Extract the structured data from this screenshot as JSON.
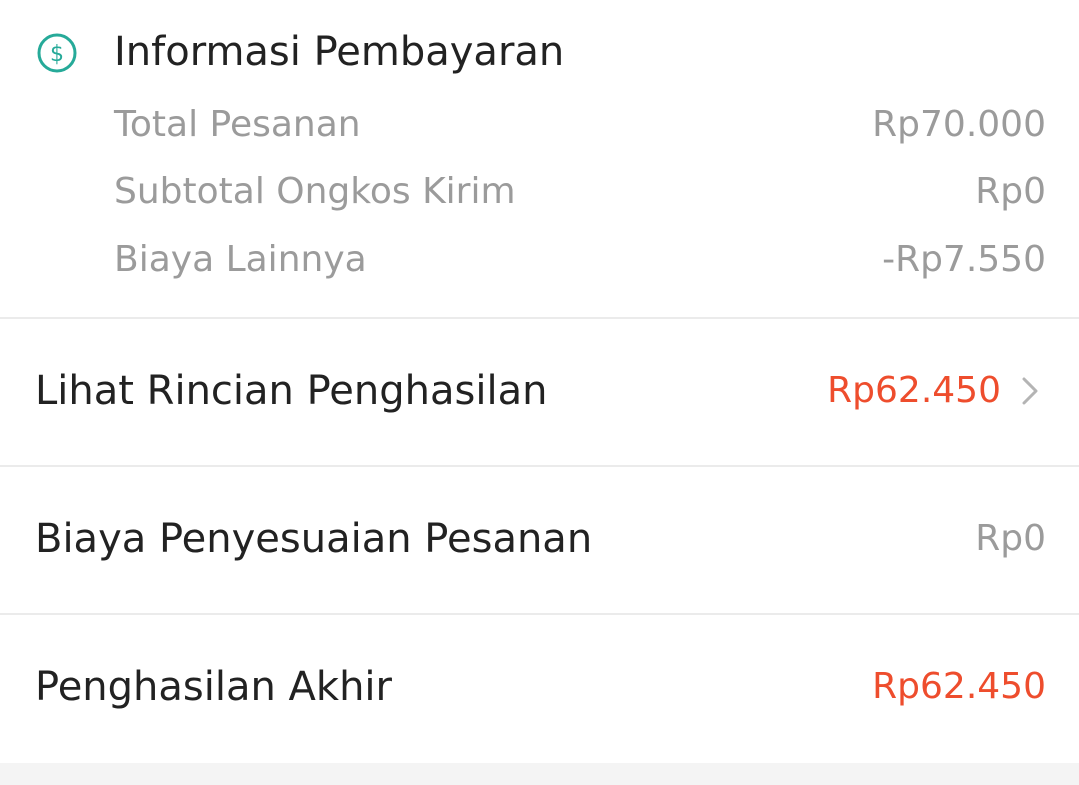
{
  "payment_info": {
    "icon": "dollar-circle-icon",
    "title": "Informasi Pembayaran",
    "items": [
      {
        "label": "Total Pesanan",
        "value": "Rp70.000"
      },
      {
        "label": "Subtotal Ongkos Kirim",
        "value": "Rp0"
      },
      {
        "label": "Biaya Lainnya",
        "value": "-Rp7.550"
      }
    ]
  },
  "income_details": {
    "label": "Lihat Rincian Penghasilan",
    "value": "Rp62.450",
    "icon": "chevron-right-icon"
  },
  "order_adjustment": {
    "label": "Biaya Penyesuaian Pesanan",
    "value": "Rp0"
  },
  "final_income": {
    "label": "Penghasilan Akhir",
    "value": "Rp62.450"
  },
  "colors": {
    "accent_teal": "#26aa99",
    "price_orange": "#ee4d2d",
    "text_primary": "#222222",
    "text_secondary": "#9b9b9b"
  }
}
